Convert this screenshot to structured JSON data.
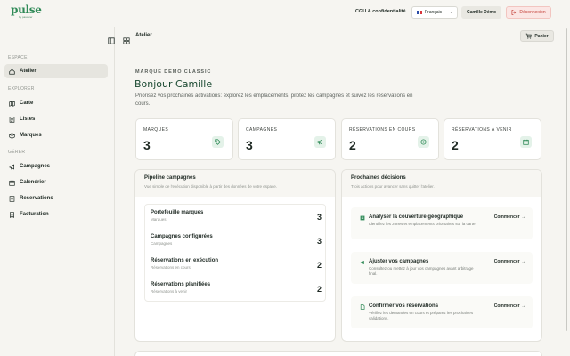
{
  "header": {
    "logo_text": "pulse",
    "logo_sub": "by pasquier",
    "privacy_link": "CGU & confidentialité",
    "language": "Français",
    "user": "Camille Démo",
    "logout": "Déconnexion"
  },
  "sidebar": {
    "sections": [
      {
        "title": "ESPACE",
        "items": [
          {
            "label": "Atelier",
            "icon": "home-icon",
            "active": true
          }
        ]
      },
      {
        "title": "EXPLORER",
        "items": [
          {
            "label": "Carte",
            "icon": "map-icon"
          },
          {
            "label": "Listes",
            "icon": "list-icon"
          },
          {
            "label": "Marques",
            "icon": "box-icon"
          }
        ]
      },
      {
        "title": "GÉRER",
        "items": [
          {
            "label": "Campagnes",
            "icon": "megaphone-icon"
          },
          {
            "label": "Calendrier",
            "icon": "calendar-icon"
          },
          {
            "label": "Reservations",
            "icon": "ticket-icon"
          },
          {
            "label": "Facturation",
            "icon": "receipt-icon"
          }
        ]
      }
    ]
  },
  "content": {
    "breadcrumb": "Atelier",
    "cart_label": "Panier",
    "brand_label": "MARQUE DÉMO CLASSIC",
    "greeting": "Bonjour Camille",
    "intro": "Priorisez vos prochaines activations: explorez les emplacements, pilotez les campagnes et suivez les réservations en cours.",
    "kpis": [
      {
        "label": "MARQUES",
        "value": "3",
        "icon": "tag-icon"
      },
      {
        "label": "CAMPAGNES",
        "value": "3",
        "icon": "megaphone-icon"
      },
      {
        "label": "RÉSERVATIONS EN COURS",
        "value": "2",
        "icon": "target-icon"
      },
      {
        "label": "RÉSERVATIONS À VENIR",
        "value": "2",
        "icon": "calendar-icon"
      }
    ],
    "pipeline": {
      "title": "Pipeline campagnes",
      "subtitle": "Vue simple de l'exécution disponible à partir des données de votre espace.",
      "rows": [
        {
          "name": "Portefeuille marques",
          "sub": "Marques",
          "value": "3"
        },
        {
          "name": "Campagnes configurées",
          "sub": "Campagnes",
          "value": "3"
        },
        {
          "name": "Réservations en exécution",
          "sub": "Réservations en cours",
          "value": "2"
        },
        {
          "name": "Réservations planifiées",
          "sub": "Réservations à venir",
          "value": "2"
        }
      ]
    },
    "decisions": {
      "title": "Prochaines décisions",
      "subtitle": "Trois actions pour avancer sans quitter l'atelier.",
      "items": [
        {
          "title": "Analyser la couverture géographique",
          "desc": "Identifiez les zones et emplacements prioritaires sur la carte.",
          "cta": "Commencer",
          "icon": "map-icon"
        },
        {
          "title": "Ajuster vos campagnes",
          "desc": "Consultez ou mettez à jour vos campagnes avant arbitrage final.",
          "cta": "Commencer",
          "icon": "megaphone-icon"
        },
        {
          "title": "Confirmer vos réservations",
          "desc": "Vérifiez les demandes en cours et préparez les prochaines validations.",
          "cta": "Commencer",
          "icon": "file-icon"
        }
      ]
    }
  },
  "colors": {
    "accent": "#2f8a57",
    "greeting": "#1b4a32",
    "danger": "#c4423a",
    "background": "#f6f5f1"
  }
}
